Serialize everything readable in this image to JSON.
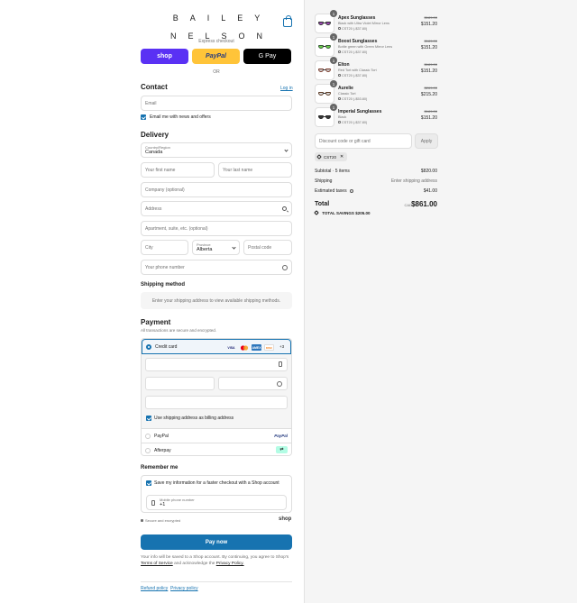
{
  "brand": {
    "line1": "BAILEY",
    "line2": "NELSON"
  },
  "express": {
    "label": "Express checkout",
    "shop": "shop",
    "paypal": "PayPal",
    "gpay": "G Pay",
    "or": "OR"
  },
  "contact": {
    "title": "Contact",
    "login": "Log in",
    "email_placeholder": "Email",
    "newsletter": "Email me with news and offers"
  },
  "delivery": {
    "title": "Delivery",
    "country_label": "Country/Region",
    "country_value": "Canada",
    "first_name": "Your first name",
    "last_name": "Your last name",
    "company": "Company (optional)",
    "address": "Address",
    "apartment": "Apartment, suite, etc. (optional)",
    "city": "City",
    "province_label": "Province",
    "province_value": "Alberta",
    "postal": "Postal code",
    "phone": "Your phone number"
  },
  "shipping": {
    "title": "Shipping method",
    "note": "Enter your shipping address to view available shipping methods."
  },
  "payment": {
    "title": "Payment",
    "subtitle": "All transactions are secure and encrypted.",
    "credit_card": "Credit card",
    "cards": [
      "VISA",
      "MC",
      "AMEX",
      "DISC"
    ],
    "more_cards": "+3",
    "billing_same": "Use shipping address as billing address",
    "paypal": "PayPal",
    "paypal_logo": "PayPal",
    "afterpay": "Afterpay"
  },
  "remember": {
    "title": "Remember me",
    "save_info": "Save my information for a faster checkout with a Shop account",
    "mobile_label": "Mobile phone number",
    "mobile_value": "+1",
    "secure": "Secure and encrypted",
    "shop": "shop"
  },
  "pay_now": "Pay now",
  "legal": {
    "text": "Your info will be saved to a Shop account. By continuing, you agree to Shop's",
    "tos": "Terms of Service",
    "and": "and acknowledge the",
    "privacy": "Privacy Policy."
  },
  "footer": {
    "refund": "Refund policy",
    "privacy": "Privacy policy"
  },
  "order": {
    "items": [
      {
        "qty": "1",
        "name": "Apex Sunglasses",
        "variant": "Black with Ultra Violet Mirror Lens",
        "discount": "CST20 (-$37.80)",
        "old_price": "$189.00",
        "price": "$151.20",
        "frame": "#2b2b2b",
        "lens": "#a04ab8"
      },
      {
        "qty": "1",
        "name": "Boost Sunglasses",
        "variant": "Bottle green with Green Mirror Lens",
        "discount": "CST20 (-$37.80)",
        "old_price": "$189.00",
        "price": "$151.20",
        "frame": "#3a5a3a",
        "lens": "#6ad04a"
      },
      {
        "qty": "1",
        "name": "Elton",
        "variant": "Red Tort with Classic Tort",
        "discount": "CST20 (-$37.80)",
        "old_price": "$189.00",
        "price": "$151.20",
        "frame": "#7a3a2a",
        "lens": "#c9c9c9"
      },
      {
        "qty": "1",
        "name": "Aurelie",
        "variant": "Classic Tort",
        "discount": "CST20 (-$53.80)",
        "old_price": "$269.00",
        "price": "$215.20",
        "frame": "#5a3a24",
        "lens": "#d8d8d8"
      },
      {
        "qty": "1",
        "name": "Imperial Sunglasses",
        "variant": "Black",
        "discount": "CST20 (-$37.80)",
        "old_price": "$189.00",
        "price": "$151.20",
        "frame": "#1f1f1f",
        "lens": "#3a3a3a"
      }
    ],
    "discount_placeholder": "Discount code or gift card",
    "apply": "Apply",
    "code_chip": "CST20",
    "subtotal_label": "Subtotal · 5 items",
    "subtotal": "$820.00",
    "shipping_label": "Shipping",
    "shipping_value": "Enter shipping address",
    "taxes_label": "Estimated taxes",
    "taxes_value": "$41.00",
    "total_label": "Total",
    "currency": "CAD",
    "total": "$861.00",
    "savings_label": "TOTAL SAVINGS",
    "savings": "$205.00"
  },
  "colors": {
    "accent": "#1773b0",
    "shop_purple": "#5a31f4",
    "paypal_yellow": "#ffc439"
  }
}
